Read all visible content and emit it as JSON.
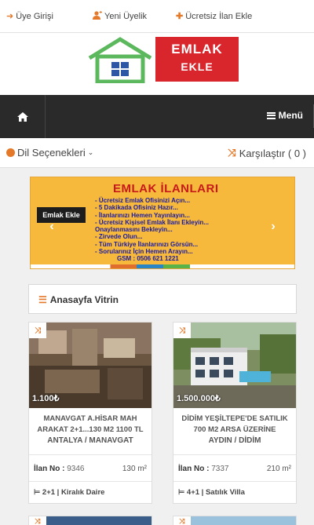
{
  "topbar": {
    "login": "Üye Girişi",
    "register": "Yeni Üyelik",
    "add_listing": "Ücretsiz İlan Ekle"
  },
  "logo": {
    "line1": "EMLAK",
    "line2": "EKLE"
  },
  "nav": {
    "menu_label": "Menü"
  },
  "options": {
    "language": "Dil Seçenekleri",
    "compare": "Karşılaştır ( 0 )"
  },
  "banner": {
    "title": "EMLAK İLANLARI",
    "label": "Emlak Ekle",
    "lines": [
      "- Ücretsiz Emlak Ofisinizi Açın...",
      "- 5 Dakikada Ofisiniz Hazır...",
      "- İlanlarınızı Hemen Yayınlayın...",
      "- Ücretsiz Kişisel Emlak İlanı Ekleyin...",
      "  Onaylanmasını Bekleyin...",
      "- Zirvede Olun...",
      "- Tüm Türkiye İlanlarınızı Görsün...",
      "- Sorularınız İçin Hemen Arayın...",
      "GSM : 0506 621 1221"
    ]
  },
  "showcase": {
    "title": "Anasayfa Vitrin"
  },
  "listings": [
    {
      "price": "1.100₺",
      "title_line1": "MANAVGAT A.HİSAR MAH",
      "title_line2": "ARAKAT 2+1...130 M2 1100 TL",
      "location": "ANTALYA / MANAVGAT",
      "no_label": "İlan No :",
      "no_value": "9346",
      "area": "130 m²",
      "type": "2+1 | Kiralık Daire"
    },
    {
      "price": "1.500.000₺",
      "title_line1": "DİDİM YEŞİLTEPE'DE SATILIK",
      "title_line2": "700 M2 ARSA ÜZERİNE",
      "location": "AYDIN / DİDİM",
      "no_label": "İlan No :",
      "no_value": "7337",
      "area": "210 m²",
      "type": "4+1 | Satılık Villa"
    }
  ],
  "colors": {
    "accent": "#e5792a",
    "logo_red": "#d8262c",
    "logo_green": "#5cb85c",
    "nav_bg": "#2a2a2a",
    "banner_bg": "#f6b93b"
  },
  "icons": {
    "login": "sign-in-icon",
    "register": "user-plus-icon",
    "add": "plus-icon",
    "home": "home-icon",
    "menu": "bars-icon",
    "globe": "globe-icon",
    "compare": "random-icon",
    "list": "list-icon",
    "bed": "bed-icon"
  }
}
